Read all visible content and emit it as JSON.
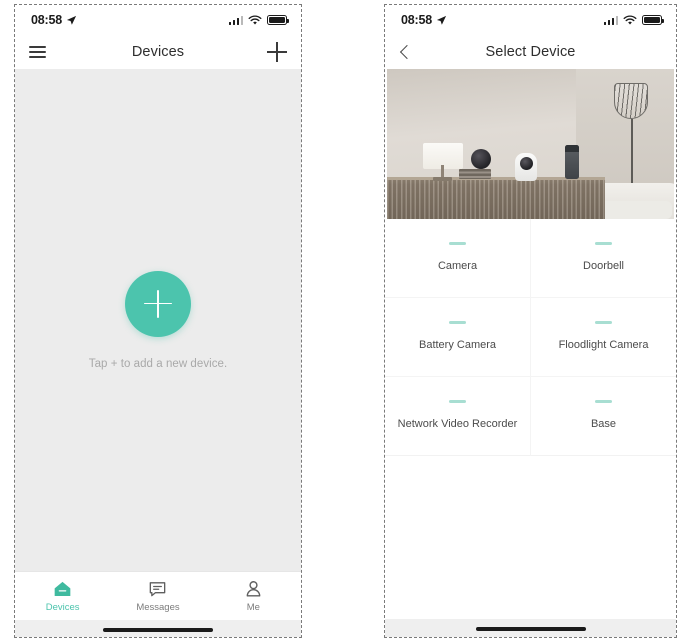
{
  "phone1": {
    "status": {
      "time": "08:58",
      "location_icon": "location-arrow-icon",
      "signal_icon": "cellular-signal-icon",
      "wifi_icon": "wifi-icon",
      "battery_icon": "battery-full-icon"
    },
    "navbar": {
      "title": "Devices",
      "menu_icon": "hamburger-menu-icon",
      "add_icon": "plus-icon"
    },
    "empty_state": {
      "fab_icon": "plus-icon",
      "hint": "Tap + to add a new device."
    },
    "tabs": [
      {
        "label": "Devices",
        "icon": "home-icon",
        "active": true
      },
      {
        "label": "Messages",
        "icon": "chat-bubble-icon",
        "active": false
      },
      {
        "label": "Me",
        "icon": "person-icon",
        "active": false
      }
    ]
  },
  "phone2": {
    "status": {
      "time": "08:58",
      "location_icon": "location-arrow-icon",
      "signal_icon": "cellular-signal-icon",
      "wifi_icon": "wifi-icon",
      "battery_icon": "battery-full-icon"
    },
    "navbar": {
      "title": "Select Device",
      "back_icon": "chevron-left-icon"
    },
    "hero": {
      "alt": "living-room-with-smart-cameras-photo"
    },
    "devices": [
      {
        "label": "Camera",
        "icon": "device-placeholder-icon"
      },
      {
        "label": "Doorbell",
        "icon": "device-placeholder-icon"
      },
      {
        "label": "Battery Camera",
        "icon": "device-placeholder-icon"
      },
      {
        "label": "Floodlight Camera",
        "icon": "device-placeholder-icon"
      },
      {
        "label": "Network Video Recorder",
        "icon": "device-placeholder-icon"
      },
      {
        "label": "Base",
        "icon": "device-placeholder-icon"
      }
    ]
  },
  "colors": {
    "accent_teal": "#4cc4ad",
    "icon_teal_light": "#a8ded2",
    "body_gray": "#ececec",
    "text_dark": "#2e2e2e",
    "text_muted": "#a9a9a9"
  }
}
